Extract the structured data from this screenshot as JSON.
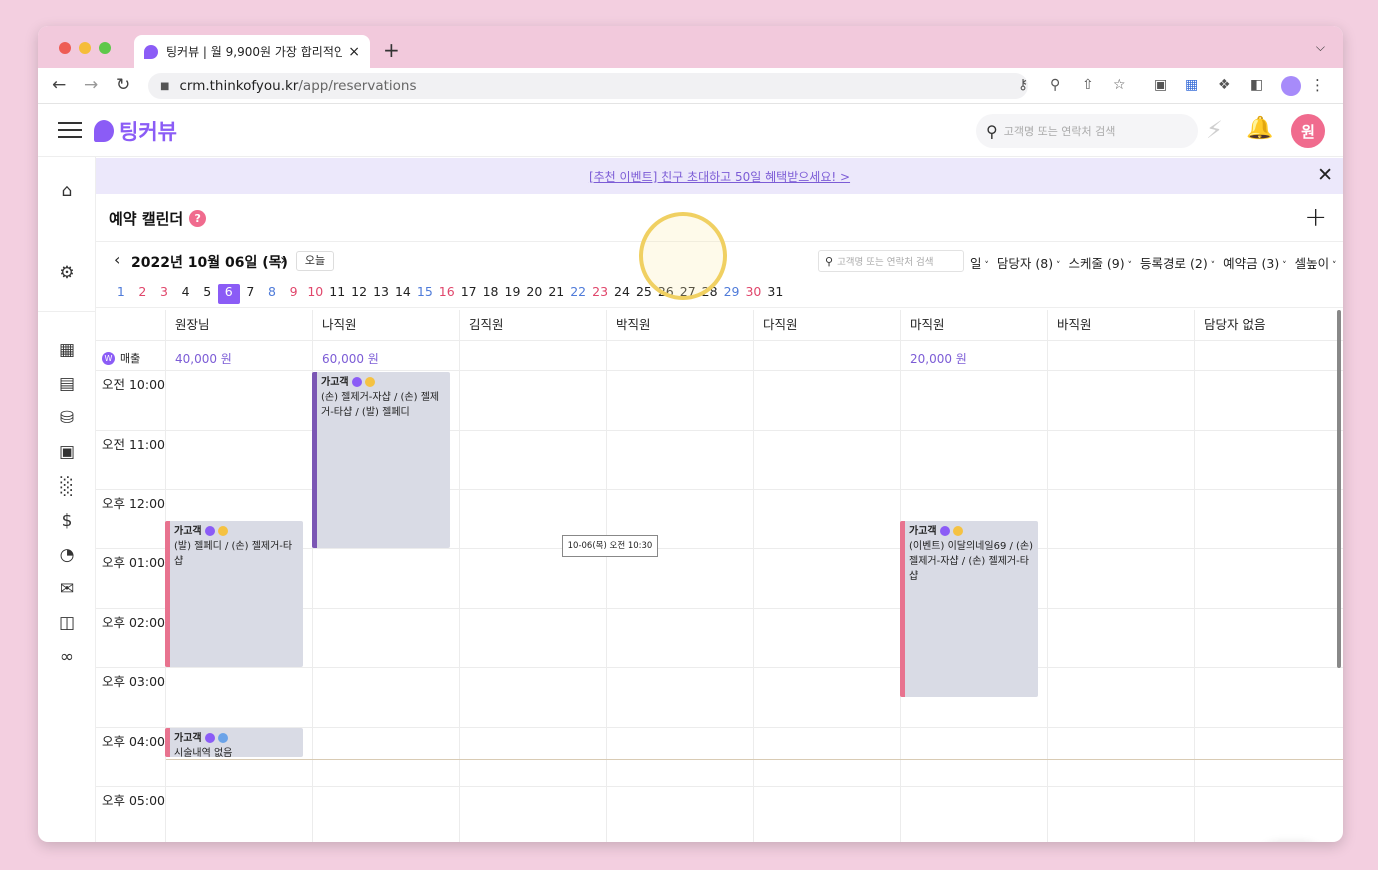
{
  "browser": {
    "tab_title": "팅커뷰 | 월 9,900원 가장 합리적인",
    "tab_close": "×",
    "new_tab": "+",
    "url_domain": "crm.thinkofyou.kr",
    "url_path": "/app/reservations"
  },
  "header": {
    "logo_text": "팅커뷰",
    "search_placeholder": "고객명 또는 연락처 검색",
    "user_initial": "원"
  },
  "banner": {
    "text": "[추천 이벤트] 친구 초대하고 50일 혜택받으세요! >"
  },
  "page": {
    "title": "예약 캘린더",
    "help": "?",
    "add": "+"
  },
  "datebar": {
    "date": "2022년 10월 06일 (목)",
    "today": "오늘",
    "search_placeholder": "고객명 또는 연락처 검색",
    "filters": [
      "일",
      "담당자 (8)",
      "스케줄 (9)",
      "등록경로 (2)",
      "예약금 (3)",
      "셀높이"
    ]
  },
  "days": [
    {
      "n": "1",
      "t": "sat"
    },
    {
      "n": "2",
      "t": "sun"
    },
    {
      "n": "3",
      "t": "sun"
    },
    {
      "n": "4",
      "t": ""
    },
    {
      "n": "5",
      "t": ""
    },
    {
      "n": "6",
      "t": "sel"
    },
    {
      "n": "7",
      "t": ""
    },
    {
      "n": "8",
      "t": "sat"
    },
    {
      "n": "9",
      "t": "sun"
    },
    {
      "n": "10",
      "t": "sun"
    },
    {
      "n": "11",
      "t": ""
    },
    {
      "n": "12",
      "t": ""
    },
    {
      "n": "13",
      "t": ""
    },
    {
      "n": "14",
      "t": ""
    },
    {
      "n": "15",
      "t": "sat"
    },
    {
      "n": "16",
      "t": "sun"
    },
    {
      "n": "17",
      "t": ""
    },
    {
      "n": "18",
      "t": ""
    },
    {
      "n": "19",
      "t": ""
    },
    {
      "n": "20",
      "t": ""
    },
    {
      "n": "21",
      "t": ""
    },
    {
      "n": "22",
      "t": "sat"
    },
    {
      "n": "23",
      "t": "sun"
    },
    {
      "n": "24",
      "t": ""
    },
    {
      "n": "25",
      "t": ""
    },
    {
      "n": "26",
      "t": ""
    },
    {
      "n": "27",
      "t": ""
    },
    {
      "n": "28",
      "t": ""
    },
    {
      "n": "29",
      "t": "sat"
    },
    {
      "n": "30",
      "t": "sun"
    },
    {
      "n": "31",
      "t": ""
    }
  ],
  "staff": [
    "원장님",
    "나직원",
    "김직원",
    "박직원",
    "다직원",
    "마직원",
    "바직원",
    "담당자 없음"
  ],
  "sales": {
    "label": "매출",
    "badge": "W",
    "values": [
      "40,000 원",
      "60,000 원",
      "",
      "",
      "",
      "20,000 원",
      "",
      ""
    ]
  },
  "times": [
    "오전 10:00",
    "오전 11:00",
    "오후 12:00",
    "오후 01:00",
    "오후 02:00",
    "오후 03:00",
    "오후 04:00",
    "오후 05:00"
  ],
  "events": [
    {
      "name": "가고객",
      "desc": "(손) 젤제거-자샵 / (손) 젤제거-타샵 / (발) 젤페디",
      "badge2": "gold",
      "color": "purple"
    },
    {
      "name": "가고객",
      "desc": "(발) 젤페디 / (손) 젤제거-타샵",
      "badge2": "gold",
      "color": "pink"
    },
    {
      "name": "가고객",
      "desc": "(이벤트) 이달의네일69 / (손) 젤제거-자샵 / (손) 젤제거-타샵",
      "badge2": "gold",
      "color": "pink"
    },
    {
      "name": "가고객",
      "desc": "시술내역 없음",
      "badge2": "blue",
      "color": "pink"
    }
  ],
  "tooltip": "10-06(목) 오전 10:30"
}
